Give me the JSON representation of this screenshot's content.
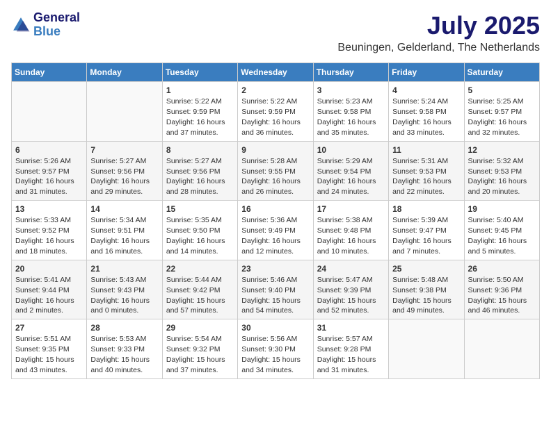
{
  "logo": {
    "line1": "General",
    "line2": "Blue"
  },
  "title": "July 2025",
  "location": "Beuningen, Gelderland, The Netherlands",
  "days_of_week": [
    "Sunday",
    "Monday",
    "Tuesday",
    "Wednesday",
    "Thursday",
    "Friday",
    "Saturday"
  ],
  "weeks": [
    [
      {
        "day": "",
        "sunrise": "",
        "sunset": "",
        "daylight": ""
      },
      {
        "day": "",
        "sunrise": "",
        "sunset": "",
        "daylight": ""
      },
      {
        "day": "1",
        "sunrise": "Sunrise: 5:22 AM",
        "sunset": "Sunset: 9:59 PM",
        "daylight": "Daylight: 16 hours and 37 minutes."
      },
      {
        "day": "2",
        "sunrise": "Sunrise: 5:22 AM",
        "sunset": "Sunset: 9:59 PM",
        "daylight": "Daylight: 16 hours and 36 minutes."
      },
      {
        "day": "3",
        "sunrise": "Sunrise: 5:23 AM",
        "sunset": "Sunset: 9:58 PM",
        "daylight": "Daylight: 16 hours and 35 minutes."
      },
      {
        "day": "4",
        "sunrise": "Sunrise: 5:24 AM",
        "sunset": "Sunset: 9:58 PM",
        "daylight": "Daylight: 16 hours and 33 minutes."
      },
      {
        "day": "5",
        "sunrise": "Sunrise: 5:25 AM",
        "sunset": "Sunset: 9:57 PM",
        "daylight": "Daylight: 16 hours and 32 minutes."
      }
    ],
    [
      {
        "day": "6",
        "sunrise": "Sunrise: 5:26 AM",
        "sunset": "Sunset: 9:57 PM",
        "daylight": "Daylight: 16 hours and 31 minutes."
      },
      {
        "day": "7",
        "sunrise": "Sunrise: 5:27 AM",
        "sunset": "Sunset: 9:56 PM",
        "daylight": "Daylight: 16 hours and 29 minutes."
      },
      {
        "day": "8",
        "sunrise": "Sunrise: 5:27 AM",
        "sunset": "Sunset: 9:56 PM",
        "daylight": "Daylight: 16 hours and 28 minutes."
      },
      {
        "day": "9",
        "sunrise": "Sunrise: 5:28 AM",
        "sunset": "Sunset: 9:55 PM",
        "daylight": "Daylight: 16 hours and 26 minutes."
      },
      {
        "day": "10",
        "sunrise": "Sunrise: 5:29 AM",
        "sunset": "Sunset: 9:54 PM",
        "daylight": "Daylight: 16 hours and 24 minutes."
      },
      {
        "day": "11",
        "sunrise": "Sunrise: 5:31 AM",
        "sunset": "Sunset: 9:53 PM",
        "daylight": "Daylight: 16 hours and 22 minutes."
      },
      {
        "day": "12",
        "sunrise": "Sunrise: 5:32 AM",
        "sunset": "Sunset: 9:53 PM",
        "daylight": "Daylight: 16 hours and 20 minutes."
      }
    ],
    [
      {
        "day": "13",
        "sunrise": "Sunrise: 5:33 AM",
        "sunset": "Sunset: 9:52 PM",
        "daylight": "Daylight: 16 hours and 18 minutes."
      },
      {
        "day": "14",
        "sunrise": "Sunrise: 5:34 AM",
        "sunset": "Sunset: 9:51 PM",
        "daylight": "Daylight: 16 hours and 16 minutes."
      },
      {
        "day": "15",
        "sunrise": "Sunrise: 5:35 AM",
        "sunset": "Sunset: 9:50 PM",
        "daylight": "Daylight: 16 hours and 14 minutes."
      },
      {
        "day": "16",
        "sunrise": "Sunrise: 5:36 AM",
        "sunset": "Sunset: 9:49 PM",
        "daylight": "Daylight: 16 hours and 12 minutes."
      },
      {
        "day": "17",
        "sunrise": "Sunrise: 5:38 AM",
        "sunset": "Sunset: 9:48 PM",
        "daylight": "Daylight: 16 hours and 10 minutes."
      },
      {
        "day": "18",
        "sunrise": "Sunrise: 5:39 AM",
        "sunset": "Sunset: 9:47 PM",
        "daylight": "Daylight: 16 hours and 7 minutes."
      },
      {
        "day": "19",
        "sunrise": "Sunrise: 5:40 AM",
        "sunset": "Sunset: 9:45 PM",
        "daylight": "Daylight: 16 hours and 5 minutes."
      }
    ],
    [
      {
        "day": "20",
        "sunrise": "Sunrise: 5:41 AM",
        "sunset": "Sunset: 9:44 PM",
        "daylight": "Daylight: 16 hours and 2 minutes."
      },
      {
        "day": "21",
        "sunrise": "Sunrise: 5:43 AM",
        "sunset": "Sunset: 9:43 PM",
        "daylight": "Daylight: 16 hours and 0 minutes."
      },
      {
        "day": "22",
        "sunrise": "Sunrise: 5:44 AM",
        "sunset": "Sunset: 9:42 PM",
        "daylight": "Daylight: 15 hours and 57 minutes."
      },
      {
        "day": "23",
        "sunrise": "Sunrise: 5:46 AM",
        "sunset": "Sunset: 9:40 PM",
        "daylight": "Daylight: 15 hours and 54 minutes."
      },
      {
        "day": "24",
        "sunrise": "Sunrise: 5:47 AM",
        "sunset": "Sunset: 9:39 PM",
        "daylight": "Daylight: 15 hours and 52 minutes."
      },
      {
        "day": "25",
        "sunrise": "Sunrise: 5:48 AM",
        "sunset": "Sunset: 9:38 PM",
        "daylight": "Daylight: 15 hours and 49 minutes."
      },
      {
        "day": "26",
        "sunrise": "Sunrise: 5:50 AM",
        "sunset": "Sunset: 9:36 PM",
        "daylight": "Daylight: 15 hours and 46 minutes."
      }
    ],
    [
      {
        "day": "27",
        "sunrise": "Sunrise: 5:51 AM",
        "sunset": "Sunset: 9:35 PM",
        "daylight": "Daylight: 15 hours and 43 minutes."
      },
      {
        "day": "28",
        "sunrise": "Sunrise: 5:53 AM",
        "sunset": "Sunset: 9:33 PM",
        "daylight": "Daylight: 15 hours and 40 minutes."
      },
      {
        "day": "29",
        "sunrise": "Sunrise: 5:54 AM",
        "sunset": "Sunset: 9:32 PM",
        "daylight": "Daylight: 15 hours and 37 minutes."
      },
      {
        "day": "30",
        "sunrise": "Sunrise: 5:56 AM",
        "sunset": "Sunset: 9:30 PM",
        "daylight": "Daylight: 15 hours and 34 minutes."
      },
      {
        "day": "31",
        "sunrise": "Sunrise: 5:57 AM",
        "sunset": "Sunset: 9:28 PM",
        "daylight": "Daylight: 15 hours and 31 minutes."
      },
      {
        "day": "",
        "sunrise": "",
        "sunset": "",
        "daylight": ""
      },
      {
        "day": "",
        "sunrise": "",
        "sunset": "",
        "daylight": ""
      }
    ]
  ]
}
